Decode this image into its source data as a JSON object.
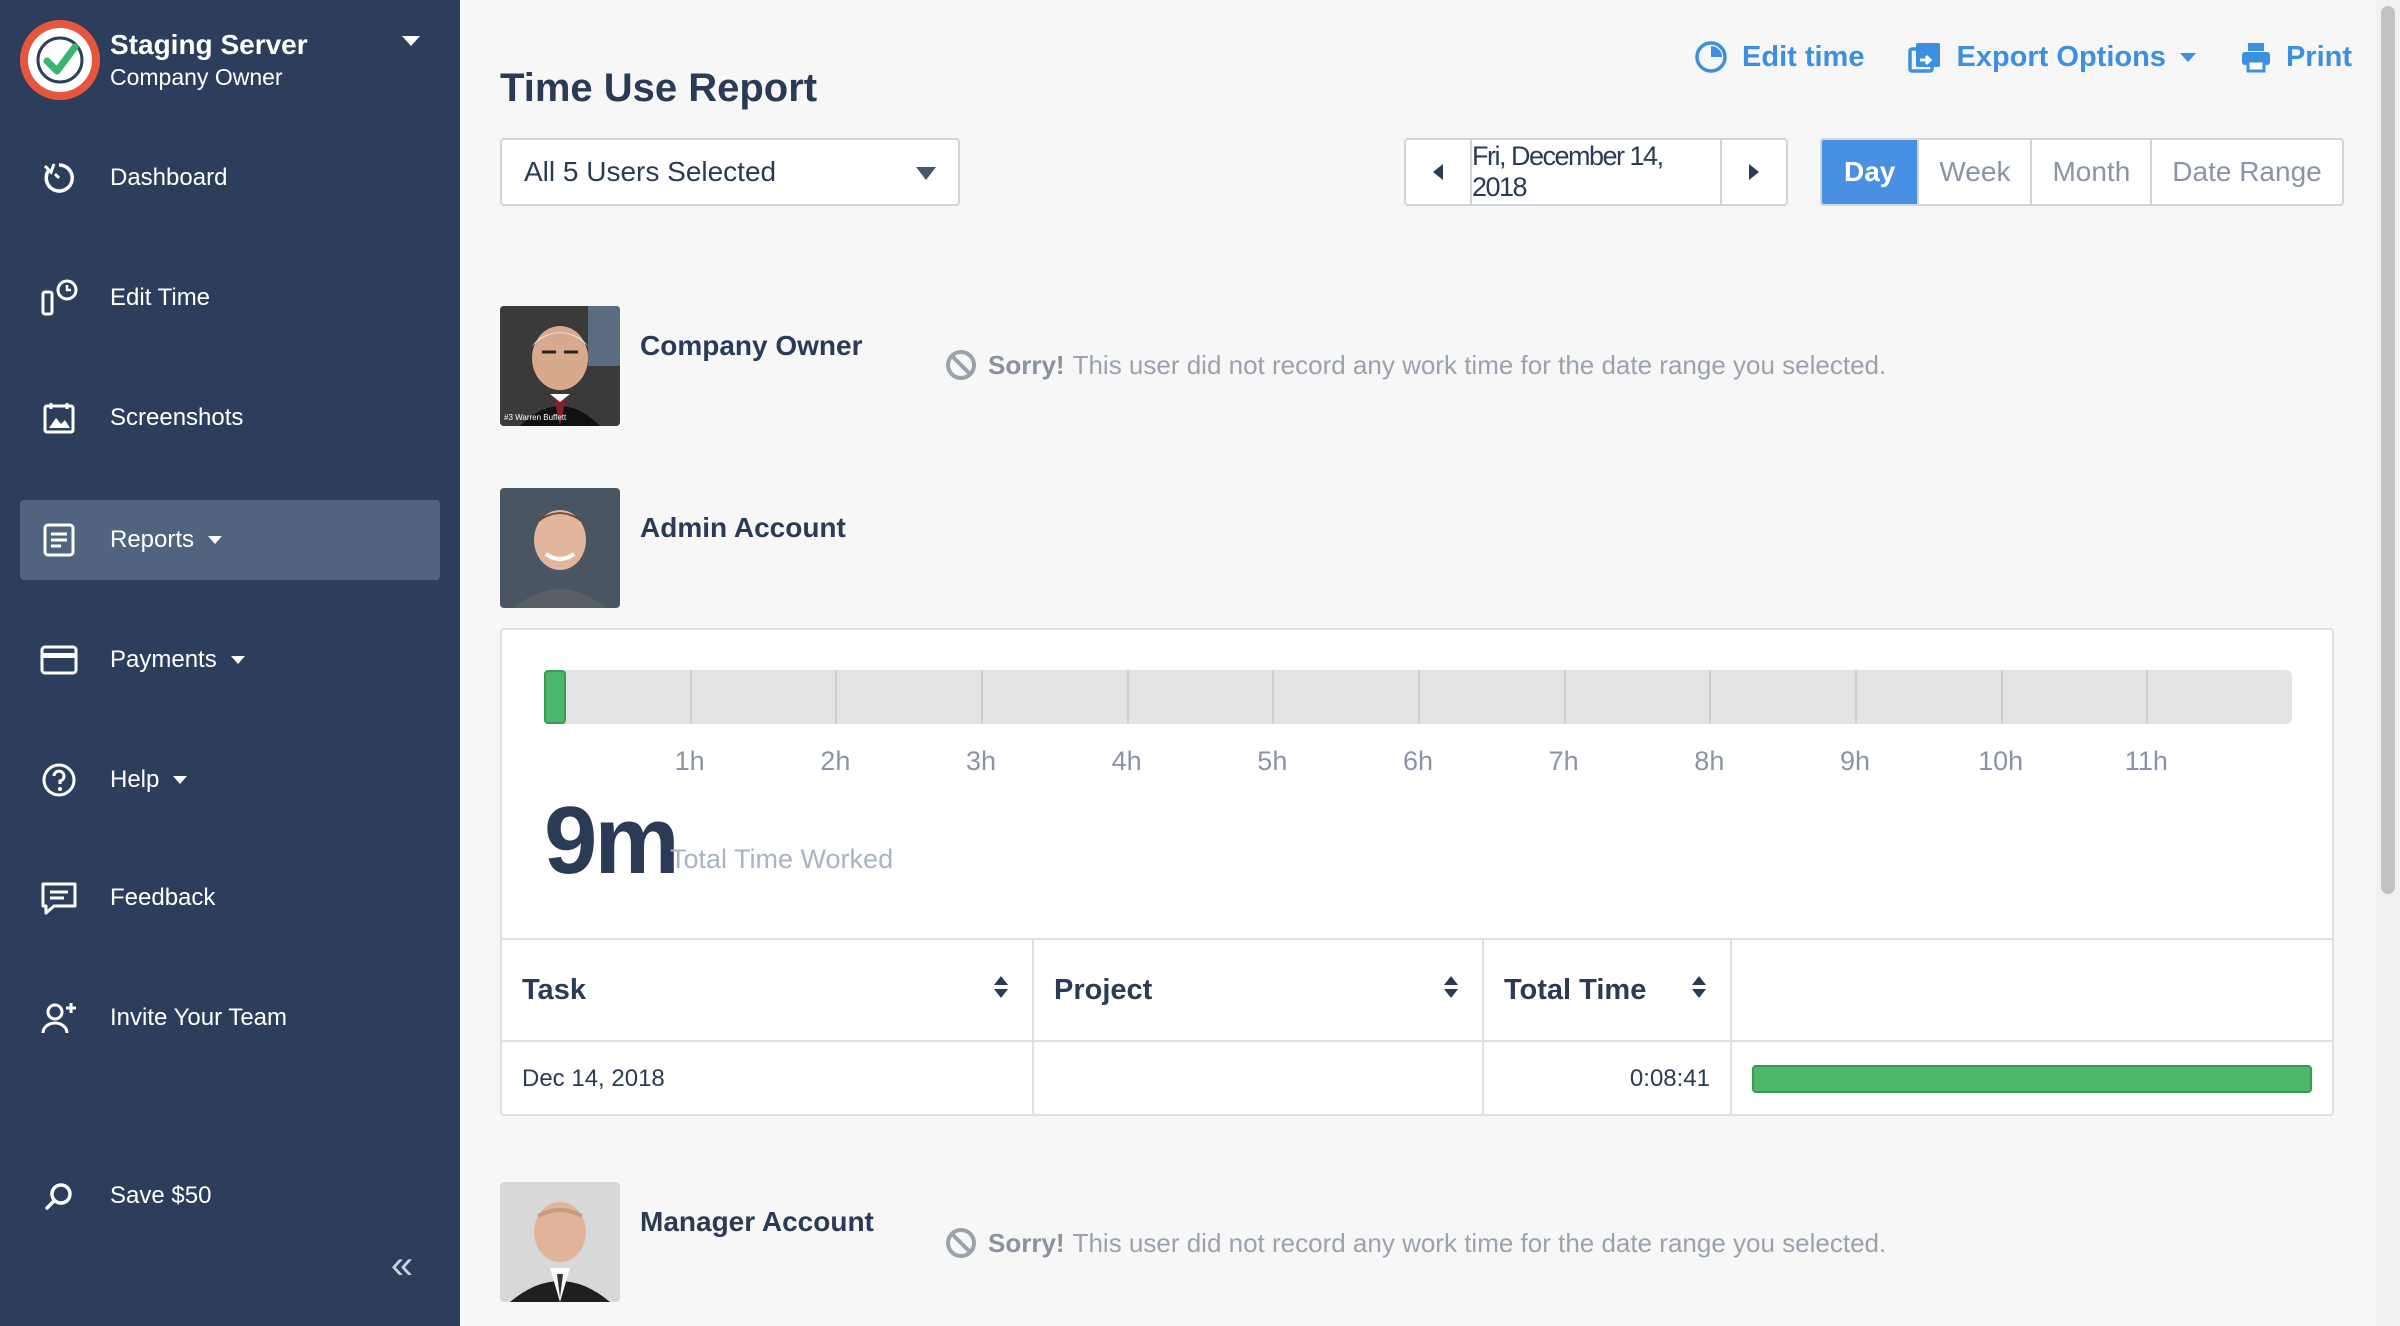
{
  "sidebar": {
    "org_name": "Staging Server",
    "role": "Company Owner",
    "items": [
      {
        "label": "Dashboard",
        "icon": "dashboard-icon"
      },
      {
        "label": "Edit Time",
        "icon": "edit-time-icon"
      },
      {
        "label": "Screenshots",
        "icon": "screenshots-icon"
      },
      {
        "label": "Reports",
        "icon": "reports-icon",
        "has_dropdown": true,
        "active": true
      },
      {
        "label": "Payments",
        "icon": "payments-icon",
        "has_dropdown": true
      },
      {
        "label": "Help",
        "icon": "help-icon",
        "has_dropdown": true
      },
      {
        "label": "Feedback",
        "icon": "feedback-icon"
      },
      {
        "label": "Invite Your Team",
        "icon": "invite-icon"
      },
      {
        "label": "Save $50",
        "icon": "save-icon"
      }
    ],
    "collapse_glyph": "«"
  },
  "header": {
    "title": "Time Use Report",
    "actions": {
      "edit_time": "Edit time",
      "export": "Export Options",
      "print": "Print"
    }
  },
  "filters": {
    "users_selected": "All 5 Users Selected",
    "date": "Fri, December 14, 2018",
    "periods": [
      "Day",
      "Week",
      "Month",
      "Date Range"
    ],
    "active_period": "Day"
  },
  "users": [
    {
      "name": "Company Owner",
      "sorry_strong": "Sorry!",
      "sorry_text": "This user did not record any work time for the date range you selected.",
      "avatar_caption": "#3 Warren Buffett"
    },
    {
      "name": "Admin Account"
    },
    {
      "name": "Manager Account",
      "sorry_strong": "Sorry!",
      "sorry_text": "This user did not record any work time for the date range you selected."
    }
  ],
  "admin_card": {
    "hour_labels": [
      "1h",
      "2h",
      "3h",
      "4h",
      "5h",
      "6h",
      "7h",
      "8h",
      "9h",
      "10h",
      "11h"
    ],
    "total_time": "9m",
    "total_label": "Total Time Worked",
    "timeline_fraction": 0.0125,
    "table": {
      "headers": [
        "Task",
        "Project",
        "Total Time",
        ""
      ],
      "rows": [
        {
          "task": "Dec 14, 2018",
          "project": "",
          "total": "0:08:41",
          "bar_fraction": 1.0
        }
      ]
    }
  },
  "colors": {
    "sidebar_bg": "#2d3e5c",
    "accent": "#4a90e2",
    "bar_green": "#4cb86a",
    "logo_red": "#e8553e"
  }
}
